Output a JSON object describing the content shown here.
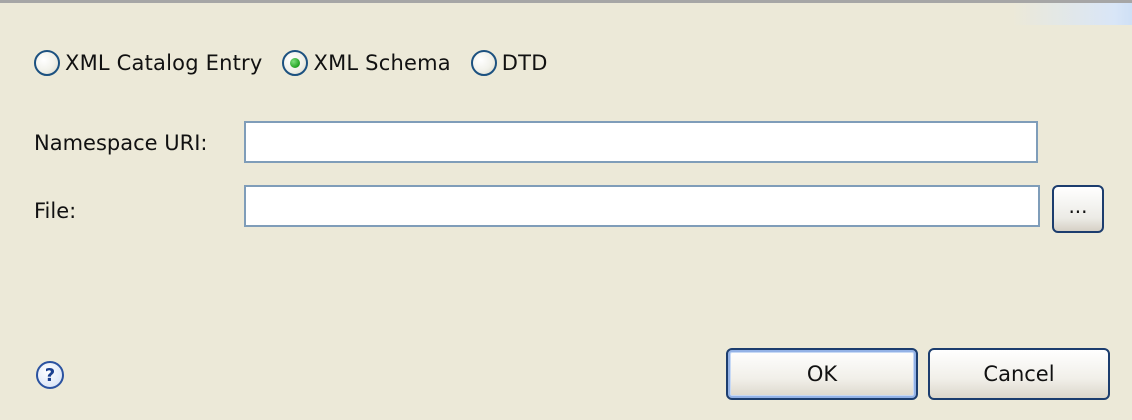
{
  "radio_group": {
    "options": [
      {
        "label": "XML Catalog Entry",
        "selected": false
      },
      {
        "label": "XML Schema",
        "selected": true
      },
      {
        "label": "DTD",
        "selected": false
      }
    ]
  },
  "form": {
    "namespace_label": "Namespace URI:",
    "namespace_value": "",
    "file_label": "File:",
    "file_value": "",
    "browse_label": "..."
  },
  "footer": {
    "help_icon": "question-mark-icon",
    "help_glyph": "?",
    "ok_label": "OK",
    "cancel_label": "Cancel"
  },
  "colors": {
    "dialog_background": "#ece9d8",
    "field_border": "#7f9db9",
    "button_border": "#1c3d6e",
    "radio_selected": "#21a121"
  }
}
